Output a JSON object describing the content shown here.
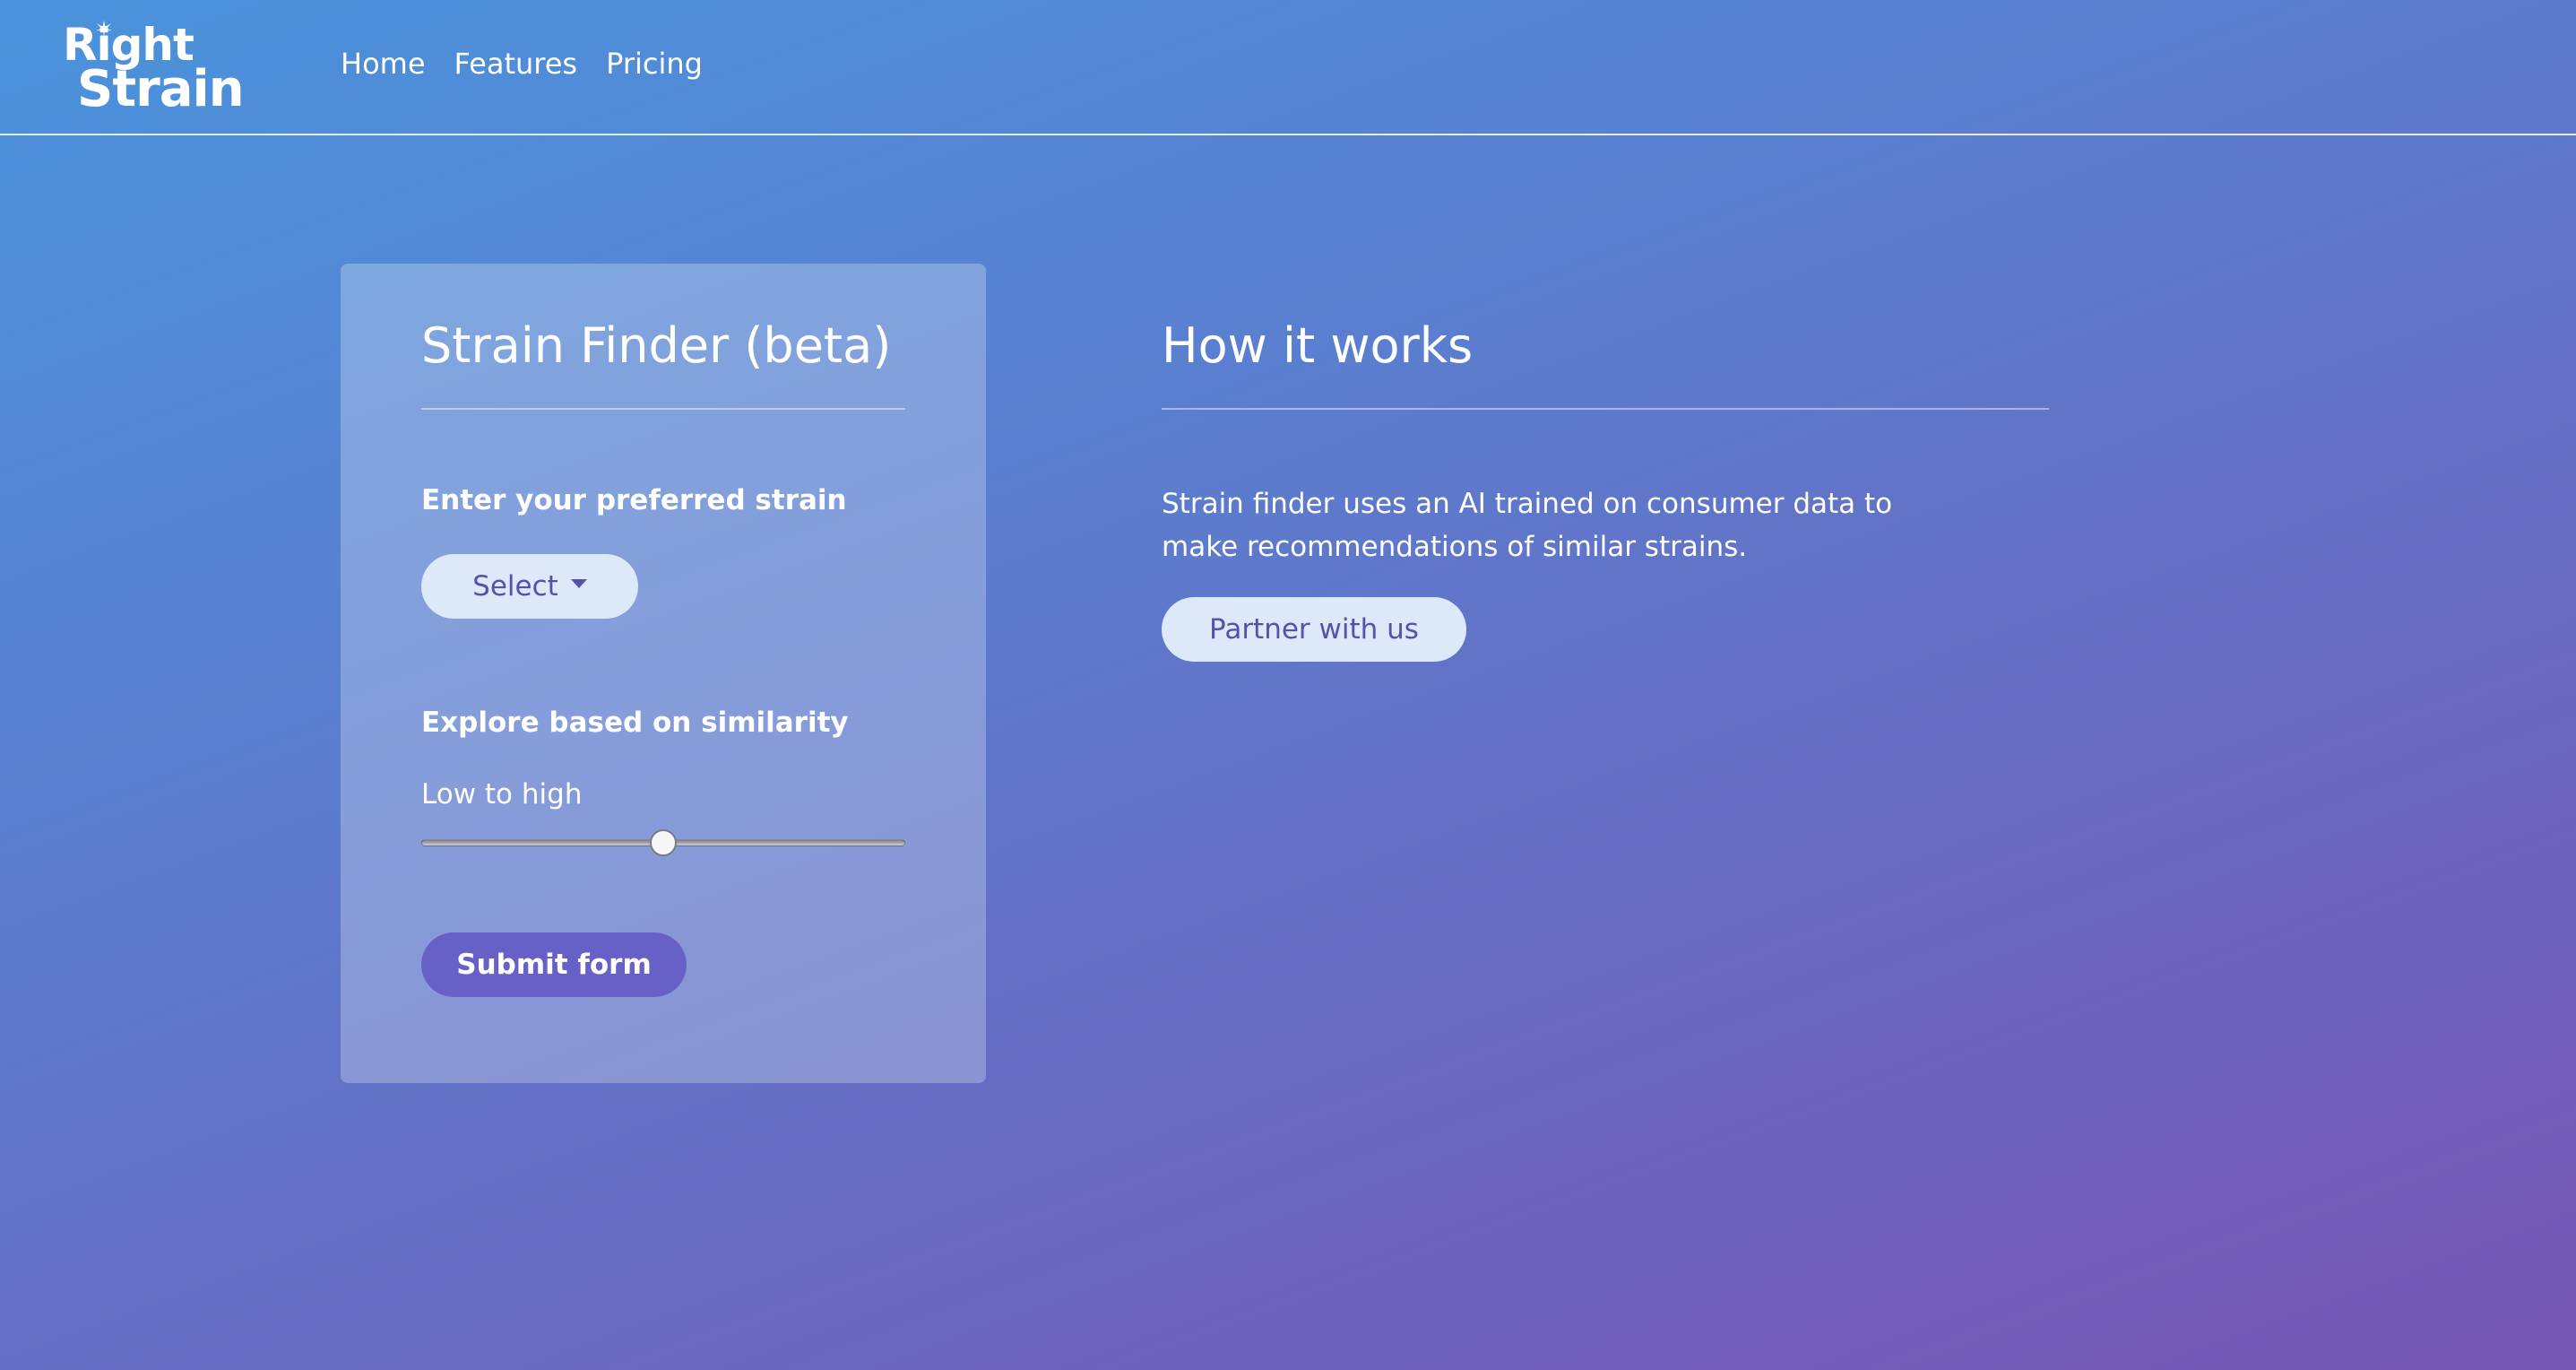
{
  "brand": {
    "logo_line1": "Right",
    "logo_line2": "Strain",
    "logo_icon": "leaf-icon"
  },
  "nav": {
    "items": [
      {
        "label": "Home"
      },
      {
        "label": "Features"
      },
      {
        "label": "Pricing"
      }
    ]
  },
  "finder": {
    "title": "Strain Finder (beta)",
    "strain_label": "Enter your preferred strain",
    "select_label": "Select",
    "select_icon": "caret-down-icon",
    "similarity_label": "Explore based on similarity",
    "range_caption": "Low to high",
    "slider_value": 0.5,
    "submit_label": "Submit form"
  },
  "how_it_works": {
    "title": "How it works",
    "description": "Strain finder uses an AI trained on consumer data to make recommendations of similar strains.",
    "partner_label": "Partner with us"
  },
  "colors": {
    "gradient_start": "#4a93dc",
    "gradient_end": "#7657b3",
    "light_button_bg": "#dbe9f8",
    "light_button_text": "#5353aa",
    "submit_button_bg": "#6760c7"
  }
}
